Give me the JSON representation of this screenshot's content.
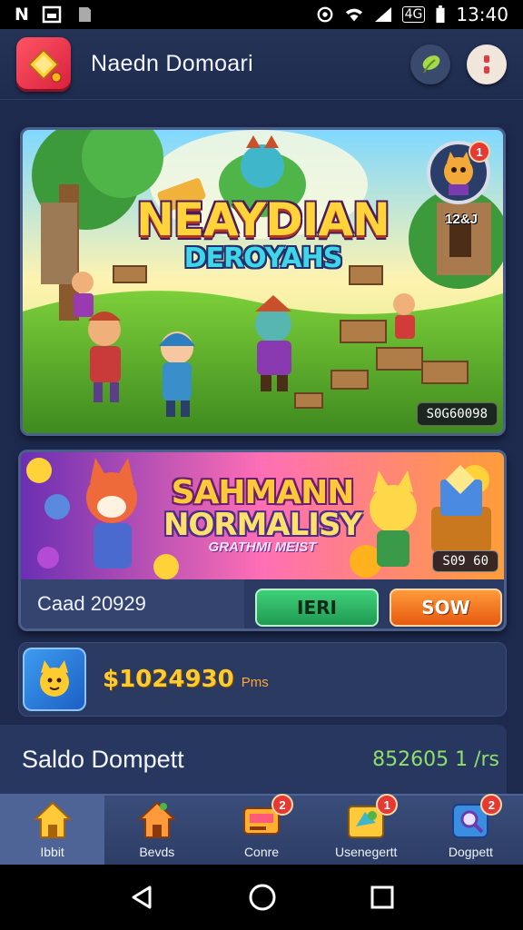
{
  "status_bar": {
    "left_glyphs": [
      "N",
      "image-icon",
      "sd-icon"
    ],
    "network_label": "4G",
    "time": "13:40"
  },
  "header": {
    "title": "Naedn Domoari",
    "logo_icon": "diamond-logo-icon",
    "actions": [
      "leaf-icon",
      "menu-icon"
    ]
  },
  "hero": {
    "title": "NEAYDIAN",
    "subtitle": "DEROYAHS",
    "level_label": "12&J",
    "avatar_badge": "1",
    "code": "S0G60098"
  },
  "promo": {
    "title": "SAHMANN",
    "subtitle": "NORMALISY",
    "tagline": "GRATHMI MEIST",
    "code": "S09 60",
    "label": "Caad 20929",
    "primary_button": "IERI",
    "secondary_button": "SOW"
  },
  "balance": {
    "amount": "$1024930",
    "unit": "Pms"
  },
  "wallet": {
    "label": "Saldo Dompett",
    "value": "852605 1 /rs"
  },
  "bottom_nav": {
    "items": [
      {
        "label": "Ibbit",
        "icon": "home-icon",
        "badge": ""
      },
      {
        "label": "Bevds",
        "icon": "house-icon",
        "badge": ""
      },
      {
        "label": "Conre",
        "icon": "card-icon",
        "badge": "2"
      },
      {
        "label": "Usenegertt",
        "icon": "gift-icon",
        "badge": "1"
      },
      {
        "label": "Dogpett",
        "icon": "search-icon",
        "badge": "2"
      }
    ],
    "active_index": 0
  },
  "colors": {
    "accent_green": "#1f9b52",
    "accent_orange": "#e65a10",
    "balance_gold": "#ffcb2e",
    "wallet_green": "#8fe06a",
    "background": "#1d2a4e"
  }
}
